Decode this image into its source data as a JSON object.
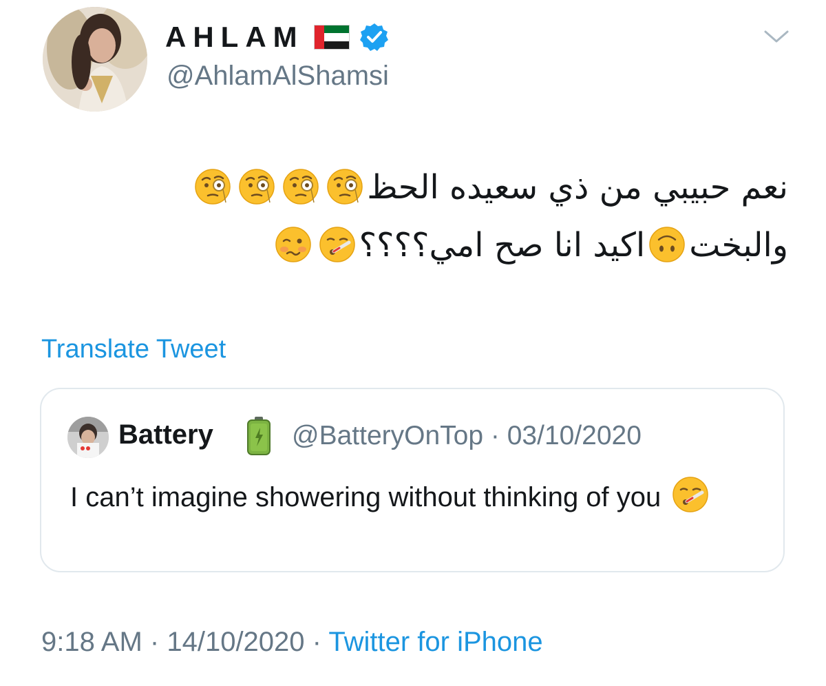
{
  "author": {
    "display_name": "AHLAM",
    "handle": "@AhlamAlShamsi",
    "flag_icon": "uae-flag-icon",
    "verified_icon": "verified-badge-icon",
    "verified_color": "#1da1f2"
  },
  "menu": {
    "icon": "chevron-down-icon"
  },
  "tweet": {
    "line1_text": "نعم حبيبي من ذي سعيده الحظ",
    "line1_emojis": [
      "face-with-monocle-emoji",
      "face-with-monocle-emoji",
      "face-with-monocle-emoji",
      "face-with-monocle-emoji"
    ],
    "line2_part1": "والبخت",
    "line2_part2": "اكيد انا صح امي؟؟؟؟",
    "line2_emojis": [
      "upside-down-face-emoji",
      "face-with-thermometer-emoji",
      "woozy-face-emoji"
    ],
    "translate_label": "Translate Tweet"
  },
  "quoted_tweet": {
    "display_name": "Battery",
    "name_icon": "battery-icon",
    "handle": "@BatteryOnTop",
    "separator": "·",
    "date": "03/10/2020",
    "text": "I can’t imagine showering without thinking of you",
    "trailing_emoji": "face-with-thermometer-emoji"
  },
  "footer": {
    "time": "9:18 AM",
    "separator": "·",
    "date": "14/10/2020",
    "source": "Twitter for iPhone"
  },
  "colors": {
    "link": "#1b95e0",
    "secondary_text": "#657786",
    "border": "#e1e8ed",
    "primary_text": "#14171a"
  }
}
